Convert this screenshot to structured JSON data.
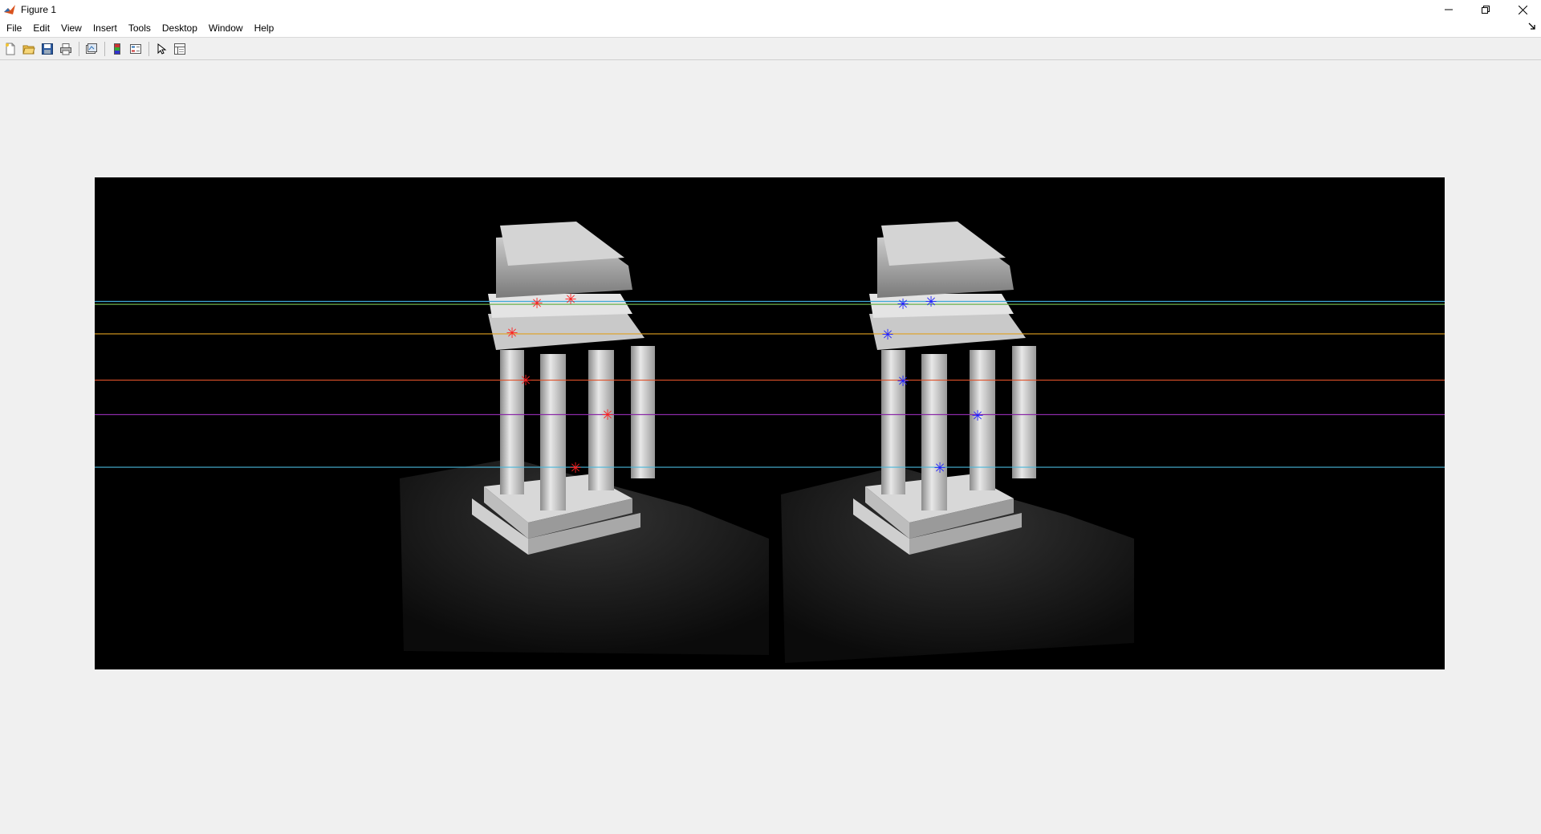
{
  "window": {
    "title": "Figure 1",
    "app_icon": "matlab-icon",
    "controls": {
      "minimize": "—",
      "restore": "❐",
      "close": "✕"
    }
  },
  "menubar": {
    "items": [
      "File",
      "Edit",
      "View",
      "Insert",
      "Tools",
      "Desktop",
      "Window",
      "Help"
    ],
    "dock_icon": "dock-arrow-icon"
  },
  "toolbar": {
    "buttons": [
      {
        "name": "new-figure-icon"
      },
      {
        "name": "open-file-icon"
      },
      {
        "name": "save-figure-icon"
      },
      {
        "name": "print-figure-icon"
      },
      {
        "name": "link-plot-icon"
      },
      {
        "name": "insert-colorbar-icon"
      },
      {
        "name": "insert-legend-icon"
      },
      {
        "name": "edit-plot-icon"
      },
      {
        "name": "property-inspector-icon"
      }
    ]
  },
  "figure": {
    "image_description": "stereo pair of temple model with epipolar lines",
    "lines": [
      {
        "color": "#3fa9d9",
        "y": 0.252
      },
      {
        "color": "#6ab04c",
        "y": 0.258
      },
      {
        "color": "#e0a020",
        "y": 0.318
      },
      {
        "color": "#e0522a",
        "y": 0.412
      },
      {
        "color": "#8a2aa6",
        "y": 0.482
      },
      {
        "color": "#49b6d9",
        "y": 0.589
      }
    ],
    "left_points_color": "#ff2020",
    "right_points_color": "#2020ff"
  }
}
